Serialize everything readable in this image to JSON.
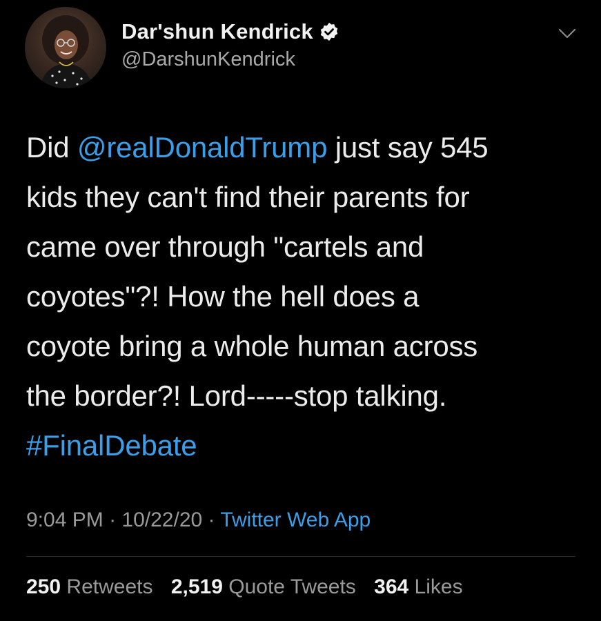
{
  "tweet": {
    "author": {
      "display_name": "Dar'shun Kendrick",
      "handle": "@DarshunKendrick",
      "verified": true
    },
    "body": {
      "line1_pre": "Did ",
      "mention": "@realDonaldTrump",
      "line1_post": " just say 545",
      "lines": [
        "kids they can't find their parents for",
        "came over through \"cartels and",
        "coyotes\"?! How the hell does a",
        "coyote bring a whole human across",
        "the border?!  Lord-----stop talking."
      ],
      "hashtag": "#FinalDebate"
    },
    "meta": {
      "time": "9:04 PM",
      "sep1": " · ",
      "date": "10/22/20",
      "sep2": " · ",
      "source": "Twitter Web App"
    },
    "stats": {
      "retweets_count": "250",
      "retweets_label": "Retweets",
      "quotes_count": "2,519",
      "quotes_label": "Quote Tweets",
      "likes_count": "364",
      "likes_label": "Likes"
    }
  },
  "icons": {
    "verified": "verified-badge-icon",
    "caret": "chevron-down-icon"
  },
  "colors": {
    "background": "#000000",
    "link": "#3a9ee8",
    "text": "#ececec",
    "secondary": "#9a9a9a"
  }
}
